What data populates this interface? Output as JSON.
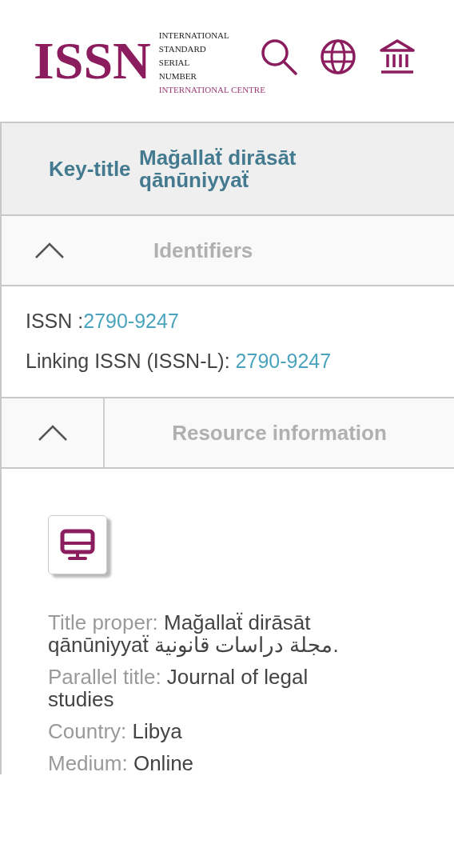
{
  "header": {
    "logo": {
      "mark": "ISSN",
      "lines": [
        "INTERNATIONAL",
        "STANDARD",
        "SERIAL",
        "NUMBER"
      ],
      "centre": "INTERNATIONAL CENTRE"
    }
  },
  "key_title": {
    "label": "Key-title",
    "value": "Mağallaẗ dirāsāt qānūniyyaẗ"
  },
  "sections": [
    {
      "title": "Identifiers",
      "expanded": true,
      "kind": "identifiers",
      "fields": [
        {
          "label": "ISSN :",
          "value": "2790-9247"
        },
        {
          "label": "Linking ISSN (ISSN-L): ",
          "value": "2790-9247"
        }
      ]
    },
    {
      "title": "Resource information",
      "expanded": true,
      "kind": "resource",
      "fields": [
        {
          "label": "Title proper: ",
          "value": "Mağallaẗ dirāsāt qānūniyyaẗ مجلة دراسات قانونية."
        },
        {
          "label": "Parallel title: ",
          "value": "Journal of legal studies"
        },
        {
          "label": "Country: ",
          "value": "Libya"
        },
        {
          "label": "Medium: ",
          "value": "Online"
        }
      ]
    }
  ]
}
